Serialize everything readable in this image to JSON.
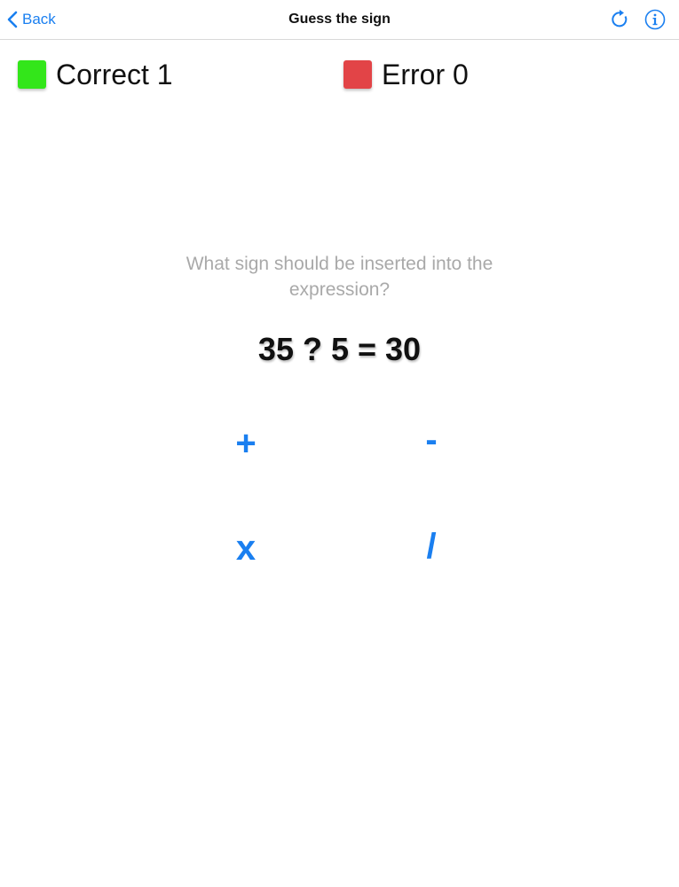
{
  "navbar": {
    "back_label": "Back",
    "title": "Guess the sign",
    "icons": {
      "back": "chevron-left-icon",
      "refresh": "refresh-icon",
      "info": "info-icon"
    },
    "accent_color": "#1a7ff0"
  },
  "scores": {
    "correct_label": "Correct 1",
    "error_label": "Error 0",
    "correct_color": "#33e61a",
    "error_color": "#e24447"
  },
  "question": {
    "prompt": "What sign should be inserted into the expression?",
    "expression": "35 ? 5 = 30"
  },
  "options": {
    "plus": "+",
    "minus": "-",
    "times": "x",
    "divide": "/"
  }
}
